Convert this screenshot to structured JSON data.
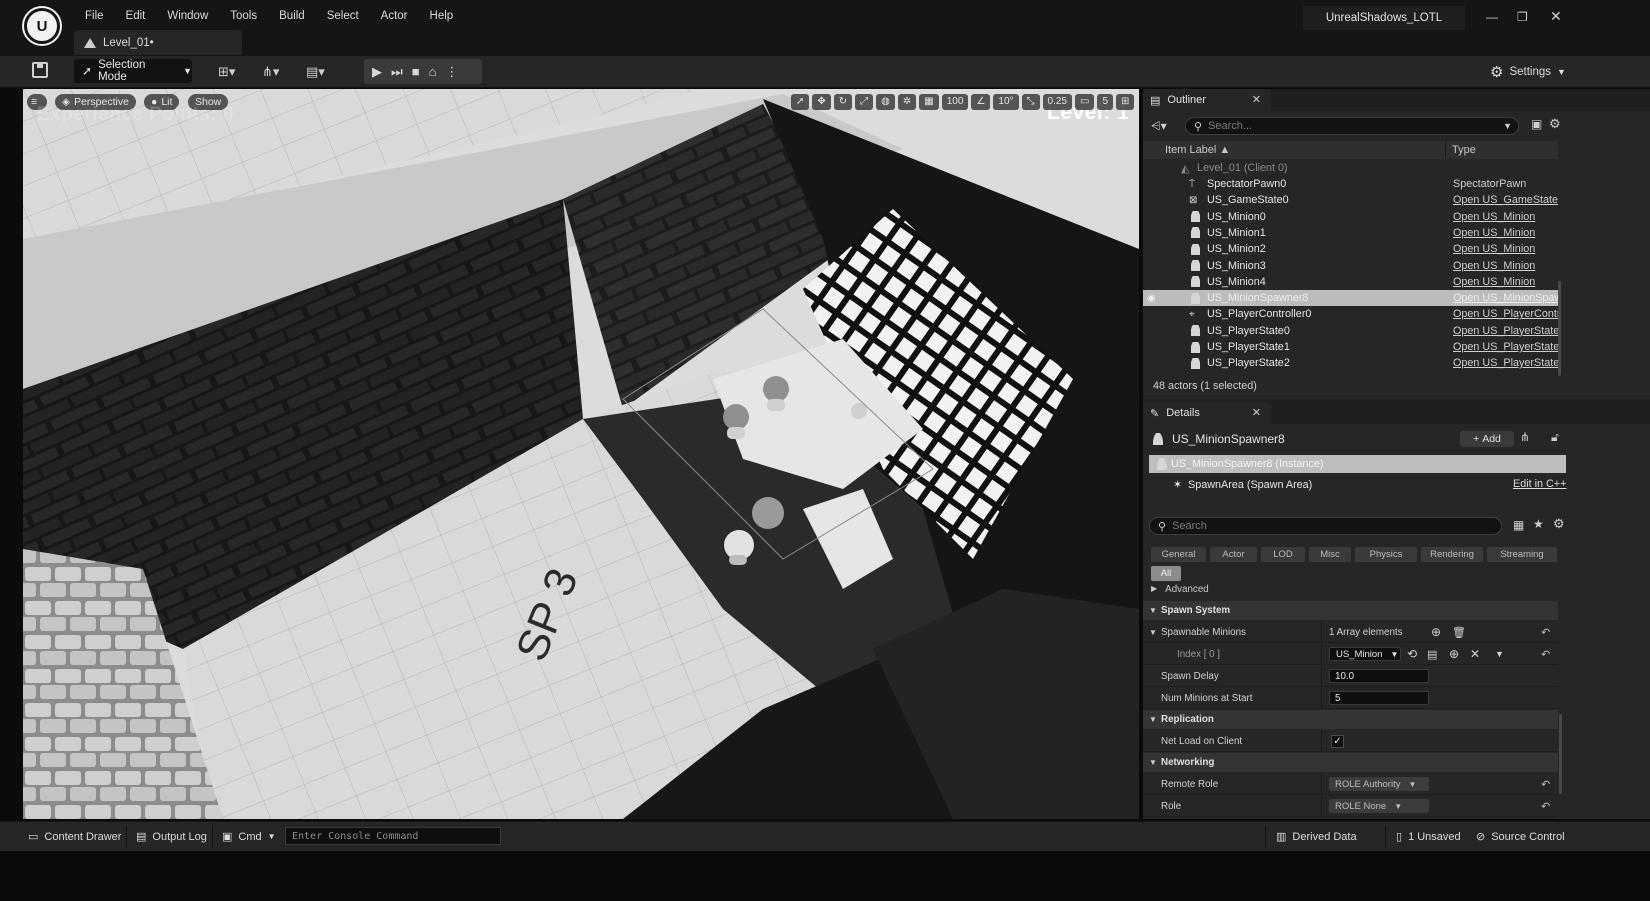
{
  "menu": [
    "File",
    "Edit",
    "Window",
    "Tools",
    "Build",
    "Select",
    "Actor",
    "Help"
  ],
  "level_tab": "Level_01•",
  "project_name": "UnrealShadows_LOTL",
  "toolbar": {
    "selection_mode": "Selection Mode",
    "settings": "Settings"
  },
  "viewport": {
    "perspective": "Perspective",
    "lit": "Lit",
    "show": "Show",
    "ghost_text": "Experience Points: 0",
    "level_text": "Level: 1",
    "grid_value": "100",
    "rot_value": "10°",
    "scale_value": "0.25",
    "cam_value": "5",
    "floor_text": "SP 3"
  },
  "outliner": {
    "tab": "Outliner",
    "search_placeholder": "Search...",
    "col_label": "Item Label ▲",
    "col_type": "Type",
    "root": "Level_01 (Client 0)",
    "rows": [
      {
        "label": "SpectatorPawn0",
        "type": "SpectatorPawn"
      },
      {
        "label": "US_GameState0",
        "type": "Open US_GameState"
      },
      {
        "label": "US_Minion0",
        "type": "Open US_Minion"
      },
      {
        "label": "US_Minion1",
        "type": "Open US_Minion"
      },
      {
        "label": "US_Minion2",
        "type": "Open US_Minion"
      },
      {
        "label": "US_Minion3",
        "type": "Open US_Minion"
      },
      {
        "label": "US_Minion4",
        "type": "Open US_Minion"
      },
      {
        "label": "US_MinionSpawner8",
        "type": "Open US_MinionSpawn"
      },
      {
        "label": "US_PlayerController0",
        "type": "Open US_PlayerContro"
      },
      {
        "label": "US_PlayerState0",
        "type": "Open US_PlayerState"
      },
      {
        "label": "US_PlayerState1",
        "type": "Open US_PlayerState"
      },
      {
        "label": "US_PlayerState2",
        "type": "Open US_PlayerState"
      }
    ],
    "footer": "48 actors (1 selected)"
  },
  "details": {
    "tab": "Details",
    "object_name": "US_MinionSpawner8",
    "add_label": "Add",
    "instance": "US_MinionSpawner8 (Instance)",
    "component": "SpawnArea (Spawn Area)",
    "edit_cpp": "Edit in C++",
    "search_placeholder": "Search",
    "categories": [
      "General",
      "Actor",
      "LOD",
      "Misc",
      "Physics",
      "Rendering",
      "Streaming"
    ],
    "category_all": "All",
    "advanced": "Advanced",
    "sections": {
      "spawn_system": "Spawn System",
      "replication": "Replication",
      "networking": "Networking"
    },
    "props": {
      "spawnable_minions": "Spawnable Minions",
      "array_elements": "1 Array elements",
      "index0": "Index [ 0 ]",
      "index0_value": "US_Minion",
      "spawn_delay": "Spawn Delay",
      "spawn_delay_value": "10.0",
      "num_minions": "Num Minions at Start",
      "num_minions_value": "5",
      "net_load": "Net Load on Client",
      "remote_role": "Remote Role",
      "remote_role_value": "ROLE Authority",
      "role": "Role",
      "role_value": "ROLE None"
    }
  },
  "statusbar": {
    "content_drawer": "Content Drawer",
    "output_log": "Output Log",
    "cmd": "Cmd",
    "console_placeholder": "Enter Console Command",
    "derived_data": "Derived Data",
    "unsaved": "1 Unsaved",
    "source_control": "Source Control"
  }
}
